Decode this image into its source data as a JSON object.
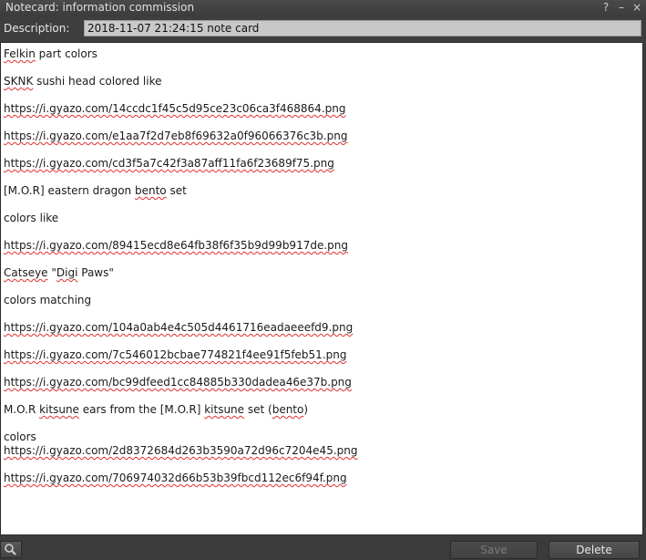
{
  "window": {
    "title": "Notecard: information commission"
  },
  "title_controls": {
    "help": "?",
    "minimize": "–",
    "close": "×"
  },
  "description": {
    "label": "Description:",
    "value": "2018-11-07 21:24:15 note card"
  },
  "notecard_lines": [
    "Felkin part colors",
    "SKNK sushi head colored like",
    "https://i.gyazo.com/14ccdc1f45c5d95ce23c06ca3f468864.png",
    "https://i.gyazo.com/e1aa7f2d7eb8f69632a0f96066376c3b.png",
    "https://i.gyazo.com/cd3f5a7c42f3a87aff11fa6f23689f75.png",
    "[M.O.R] eastern dragon bento set",
    "colors like",
    "https://i.gyazo.com/89415ecd8e64fb38f6f35b9d99b917de.png",
    "Catseye \"Digi Paws\"",
    "colors matching",
    "https://i.gyazo.com/104a0ab4e4c505d4461716eadaeeefd9.png",
    "https://i.gyazo.com/7c546012bcbae774821f4ee91f5feb51.png",
    "https://i.gyazo.com/bc99dfeed1cc84885b330dadea46e37b.png",
    "M.O.R kitsune ears from the [M.O.R] kitsune set (bento)",
    "colors",
    "https://i.gyazo.com/2d8372684d263b3590a72d96c7204e45.png",
    "https://i.gyazo.com/706974032d66b53b39fbcd112ec6f94f.png"
  ],
  "bottom": {
    "search_icon": "magnifier-icon",
    "save_label": "Save",
    "delete_label": "Delete",
    "save_enabled": false
  },
  "colors": {
    "spellcheck": "#e03030",
    "panel": "#3e3e3e",
    "note_bg": "#ffffff"
  }
}
